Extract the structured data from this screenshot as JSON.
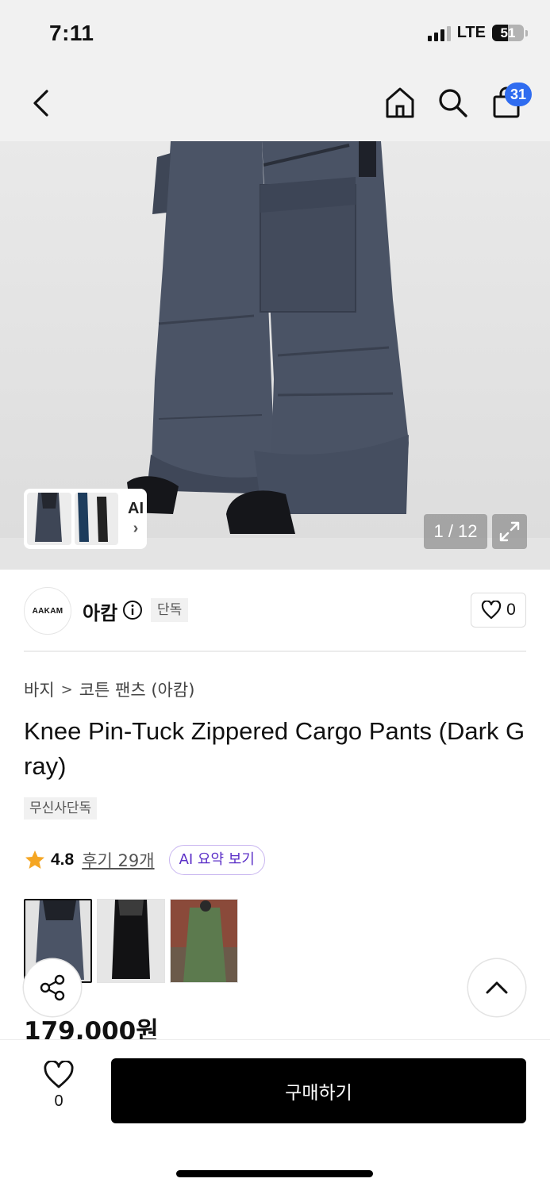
{
  "status_bar": {
    "time": "7:11",
    "network": "LTE",
    "battery_percent": "51",
    "signal_bars_active": 3,
    "signal_bars_total": 4
  },
  "nav": {
    "back_icon": "chevron-left-icon",
    "home_icon": "home-icon",
    "search_icon": "search-icon",
    "cart_icon": "shopping-bag-icon",
    "cart_count": "31",
    "badge_color": "#2f6cf0"
  },
  "gallery": {
    "ai_label": "AI",
    "ai_chevron": "›",
    "page_counter": "1 / 12",
    "expand_icon": "expand-icon"
  },
  "brand": {
    "logo_text": "AAKAM",
    "name": "아캄",
    "info_icon": "info-icon",
    "tag": "단독",
    "like_icon": "heart-outline-icon",
    "like_count": "0"
  },
  "product": {
    "breadcrumb": [
      "바지",
      "코튼 팬츠 (아캄)"
    ],
    "breadcrumb_sep": ">",
    "title": "Knee Pin-Tuck Zippered Cargo Pants (Dark Gray)",
    "exclusive_tag": "무신사단독",
    "rating_icon": "star-icon",
    "rating": "4.8",
    "review_link": "후기 29개",
    "ai_summary_label": "AI 요약 보기",
    "price": "179,000원"
  },
  "variants": [
    {
      "name": "dark-gray",
      "selected": true
    },
    {
      "name": "black",
      "selected": false
    },
    {
      "name": "khaki",
      "selected": false
    }
  ],
  "floating": {
    "share_icon": "share-icon",
    "scroll_top_icon": "chevron-up-icon"
  },
  "bottom_bar": {
    "wish_icon": "heart-outline-icon",
    "wish_count": "0",
    "buy_label": "구매하기"
  },
  "colors": {
    "accent": "#2f6cf0",
    "ai_purple": "#5b2fc7",
    "rating_star": "#f5a623",
    "buy_button": "#000000"
  }
}
